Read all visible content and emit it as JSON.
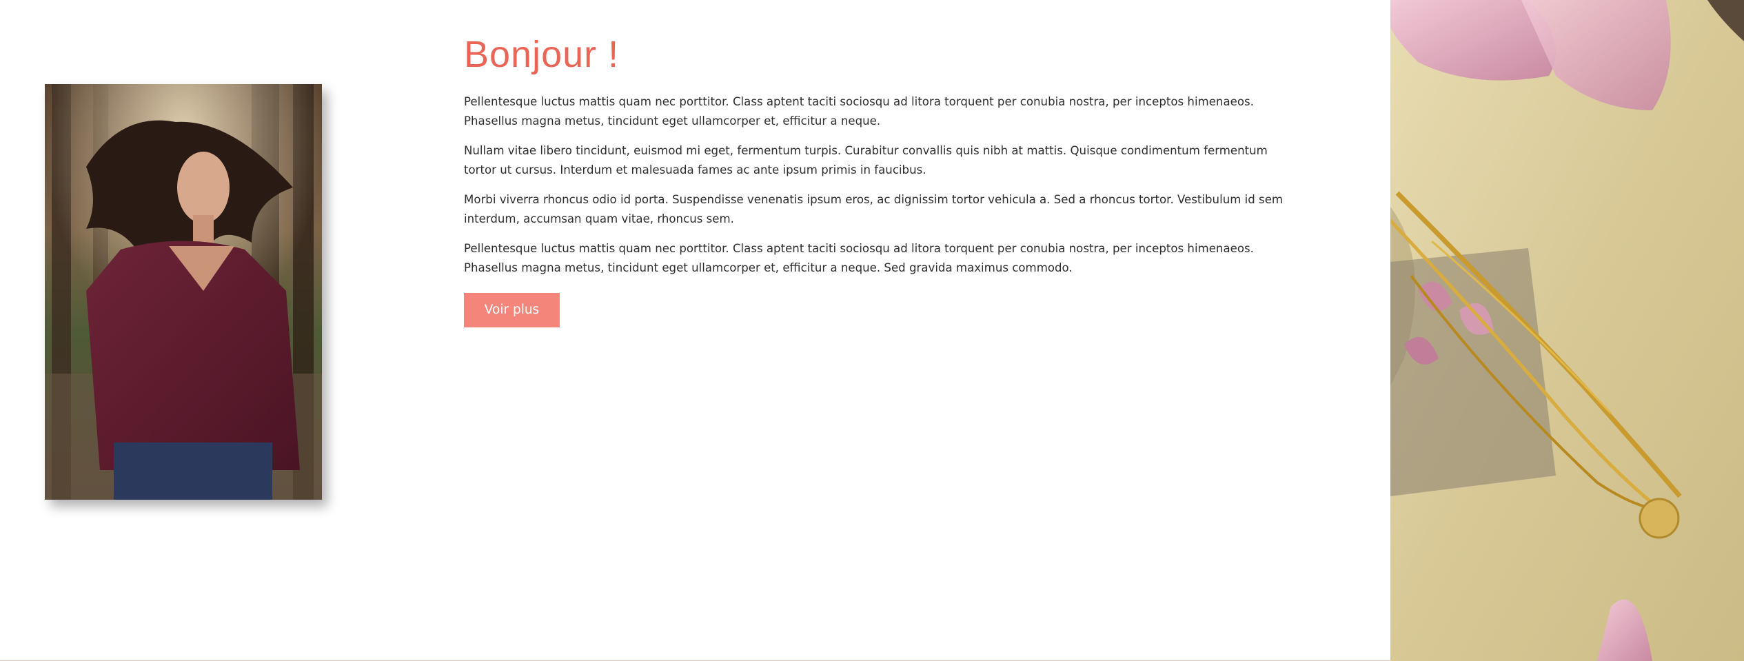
{
  "section": {
    "heading": "Bonjour !",
    "paragraphs": [
      "Pellentesque luctus mattis quam nec porttitor. Class aptent taciti sociosqu ad litora torquent per conubia nostra, per inceptos himenaeos. Phasellus magna metus, tincidunt eget ullamcorper et, efficitur a neque.",
      "Nullam vitae libero tincidunt, euismod mi eget, fermentum turpis. Curabitur convallis quis nibh at mattis. Quisque condimentum fermentum tortor ut cursus. Interdum et malesuada fames ac ante ipsum primis in faucibus.",
      "Morbi viverra rhoncus odio id porta. Suspendisse venenatis ipsum eros, ac dignissim tortor vehicula a. Sed a rhoncus tortor. Vestibulum id sem interdum, accumsan quam vitae, rhoncus sem.",
      "Pellentesque luctus mattis quam nec porttitor. Class aptent taciti sociosqu ad litora torquent per conubia nostra, per inceptos himenaeos. Phasellus magna metus, tincidunt eget ullamcorper et, efficitur a neque. Sed gravida maximus commodo."
    ],
    "button_label": "Voir plus"
  },
  "images": {
    "left": "portrait-photo",
    "right": "jewelry-photo"
  },
  "colors": {
    "heading": "#ea6556",
    "text": "#2f2f2f",
    "button_bg": "#f3857a",
    "button_text": "#ffffff",
    "bottom_rule": "#f1c9b0"
  }
}
